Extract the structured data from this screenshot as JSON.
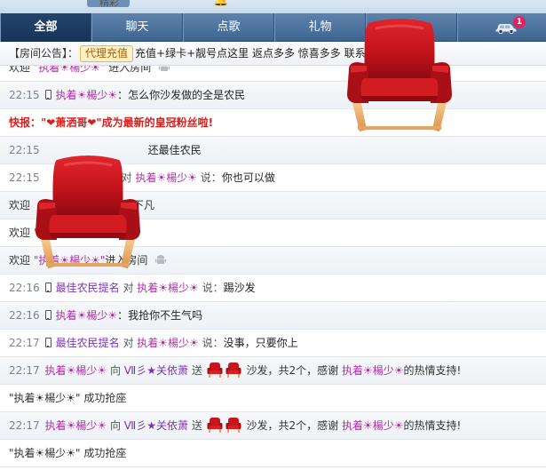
{
  "title_strip": {
    "text_left": "精彩",
    "text_right": ""
  },
  "tabs": [
    {
      "label": "全部",
      "active": true
    },
    {
      "label": "聊天",
      "active": false
    },
    {
      "label": "点歌",
      "active": false
    },
    {
      "label": "礼物",
      "active": false
    },
    {
      "label": "",
      "active": false
    }
  ],
  "car": {
    "icon": "car-icon",
    "badge": "1"
  },
  "announce": {
    "label": "【房间公告】：",
    "button": "代理充值",
    "text": "充值+绿卡+靓号点这里 返点多多 惊喜多多 联系"
  },
  "messages": {
    "m0": {
      "welcome": "欢迎",
      "nick": "\"执着☀楊少☀\"",
      "action": "进入房间"
    },
    "m1": {
      "time": "22:15",
      "nick": "执着☀楊少☀",
      "colon": "：",
      "text": "怎么你沙发做的全是农民"
    },
    "m2": {
      "prefix": "快报：",
      "nick": "\"❤萧洒哥❤\"",
      "text": "成为最新的皇冠粉丝啦!"
    },
    "m3": {
      "time": "22:15",
      "text": "还最佳农民"
    },
    "m4": {
      "time": "22:15",
      "to": "对",
      "nick": "执着☀楊少☀",
      "say": "说：",
      "text": "你也可以做"
    },
    "m5": {
      "welcome": "欢迎",
      "text": "下凡"
    },
    "m6": {
      "welcome": "欢迎",
      "nick": "\""
    },
    "m7": {
      "welcome": "欢迎",
      "nick": "\"执着☀楊少☀\"",
      "action": "进入房间"
    },
    "m8": {
      "time": "22:16",
      "from": "最佳农民提名",
      "to": "对",
      "nick": "执着☀楊少☀",
      "say": "说：",
      "text": "踢沙发"
    },
    "m9": {
      "time": "22:16",
      "nick": "执着☀楊少☀",
      "colon": "：",
      "text": "我抢你不生气吗"
    },
    "m10": {
      "time": "22:17",
      "from": "最佳农民提名",
      "to": "对",
      "nick": "执着☀楊少☀",
      "say": "说：",
      "text": "没事，只要你上"
    },
    "m11": {
      "time": "22:17",
      "from": "执着☀楊少☀",
      "to": "向",
      "target": "Ⅶ彡★关依萧",
      "send": "送",
      "gift": "沙发，共2个，感谢",
      "thank_nick": "执着☀楊少☀",
      "tail": "的热情支持!"
    },
    "m12": {
      "nick": "\"执着☀楊少☀\"",
      "text": "成功抢座"
    },
    "m13": {
      "time": "22:17",
      "from": "执着☀楊少☀",
      "to": "向",
      "target": "Ⅶ彡★关依萧",
      "send": "送",
      "gift": "沙发，共2个，感谢",
      "thank_nick": "执着☀楊少☀",
      "tail": "的热情支持!"
    },
    "m14": {
      "nick": "\"执着☀楊少☀\"",
      "text": "成功抢座"
    }
  },
  "icons": {
    "phone": "phone-icon",
    "android": "android-icon",
    "chair": "sofa-chair-icon"
  },
  "colors": {
    "tab_bg": "#4a709c",
    "tab_active": "#1d3a60",
    "nick": "#b32ea8",
    "alert": "#d62020",
    "chair_red": "#c8141c",
    "chair_wood": "#e6a460"
  }
}
